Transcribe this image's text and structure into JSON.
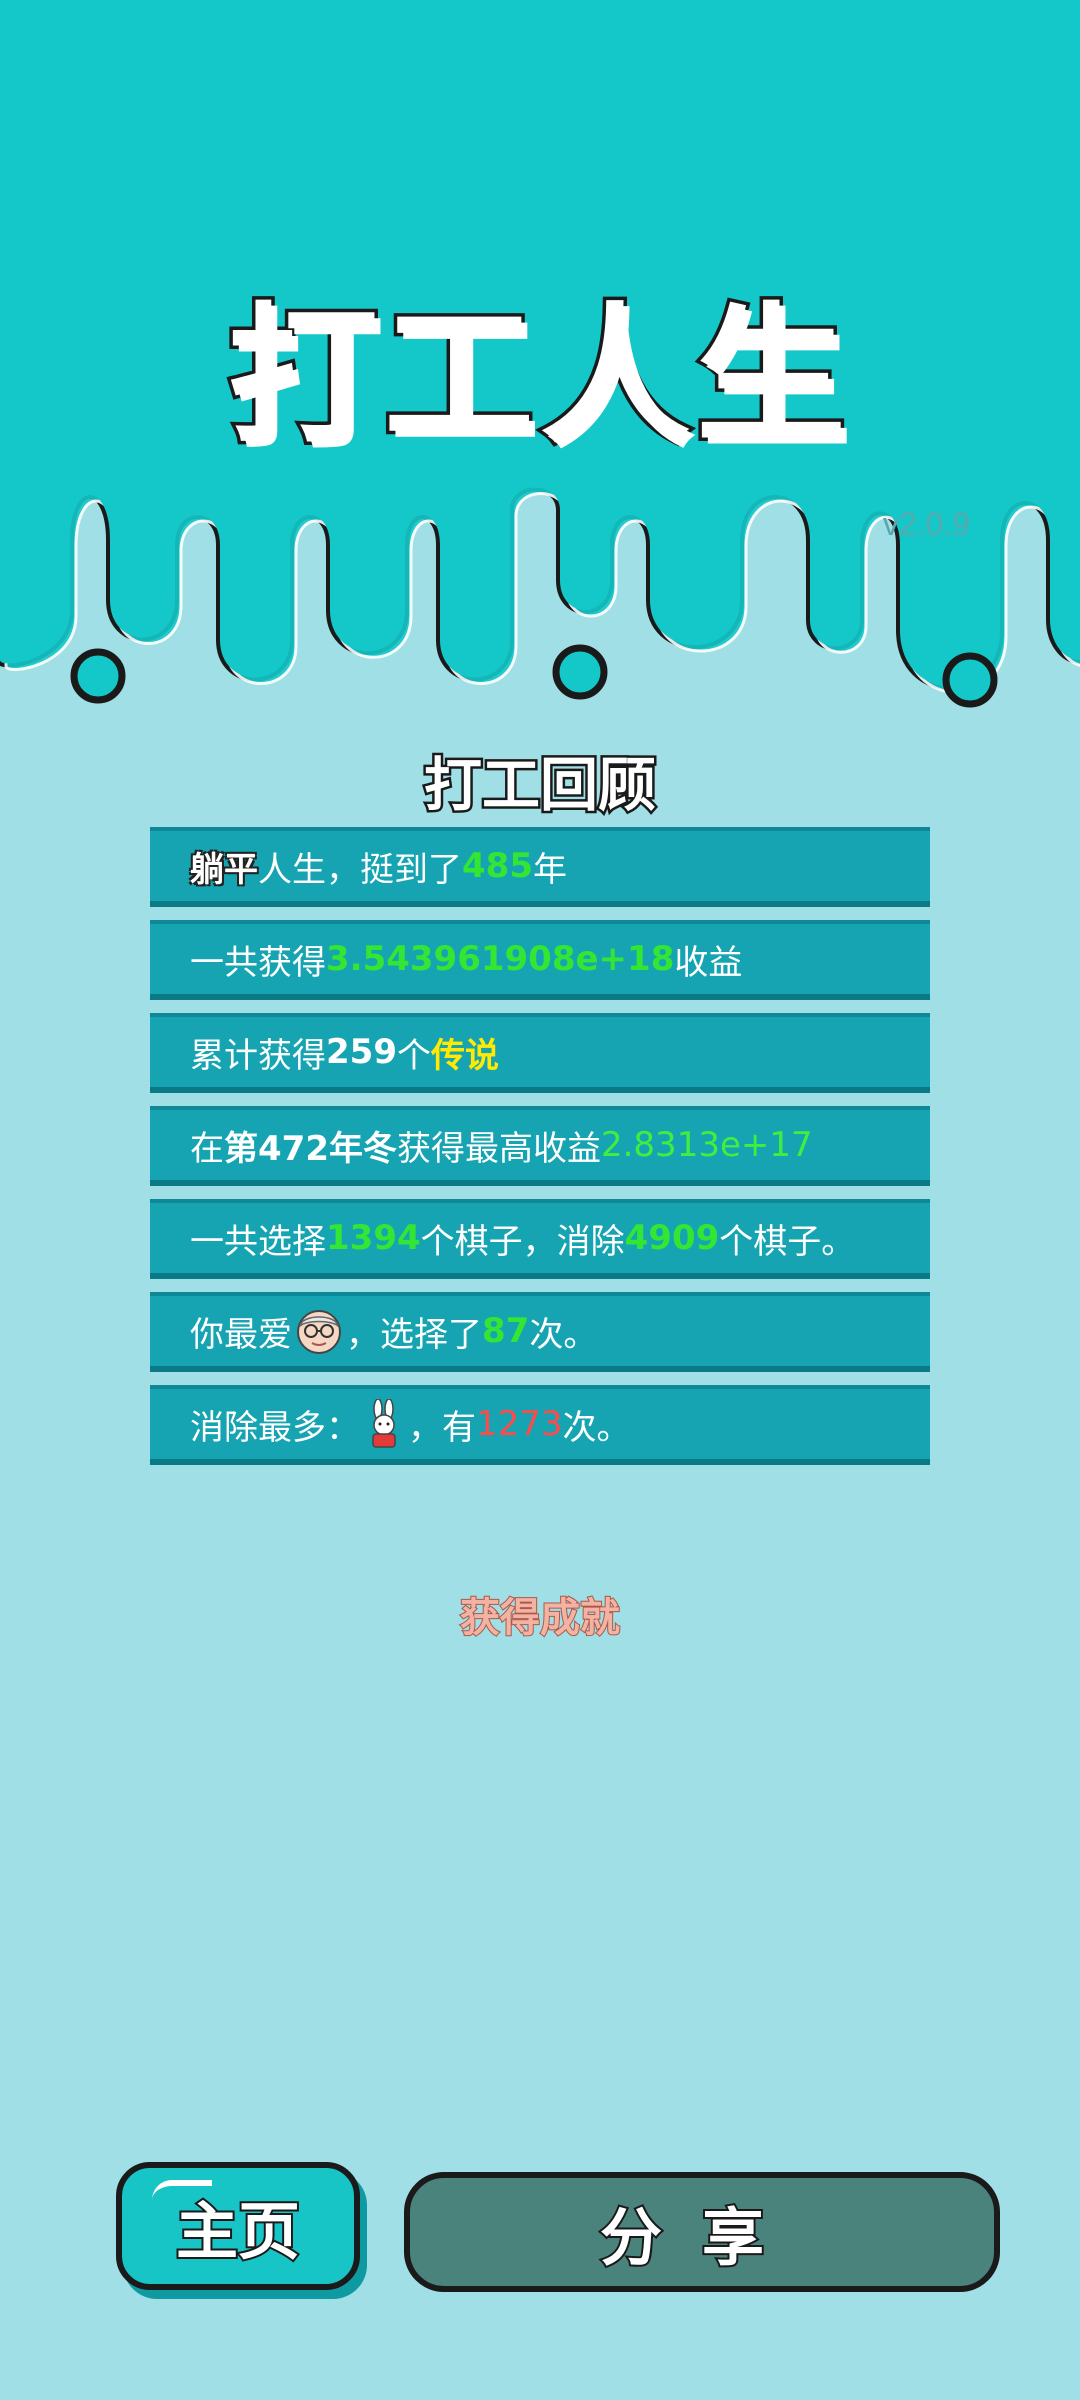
{
  "header": {
    "title": "打工人生",
    "version": "v2.0.9"
  },
  "review": {
    "title": "打工回顾",
    "rows": [
      {
        "parts": [
          "躺平",
          "人生，挺到了",
          "485",
          "年"
        ]
      },
      {
        "parts": [
          "一共获得",
          "3.543961908e+18",
          "收益"
        ]
      },
      {
        "parts": [
          "累计获得",
          "259",
          "个",
          "传说"
        ]
      },
      {
        "parts": [
          "在 ",
          "第472年冬",
          " 获得最高收益",
          "2.8313e+17"
        ]
      },
      {
        "parts": [
          "一共选择",
          "1394",
          "个棋子，消除",
          "4909",
          "个棋子。"
        ]
      },
      {
        "parts": [
          "你最爱",
          "，选择了",
          "87",
          "次。"
        ],
        "icon": "old-man-face-icon"
      },
      {
        "parts": [
          "消除最多：",
          "，有",
          "1273",
          "次。"
        ],
        "icon": "rabbit-icon"
      }
    ]
  },
  "achievement": {
    "label": "获得成就"
  },
  "buttons": {
    "home": "主页",
    "share": "分享"
  },
  "colors": {
    "top_bg": "#14c8ca",
    "page_bg": "#a0dfe6",
    "row_bg": "#17a4b2",
    "highlight_green": "#33e633",
    "legend_yellow": "#ffea00",
    "count_red": "#ff4a4a"
  }
}
